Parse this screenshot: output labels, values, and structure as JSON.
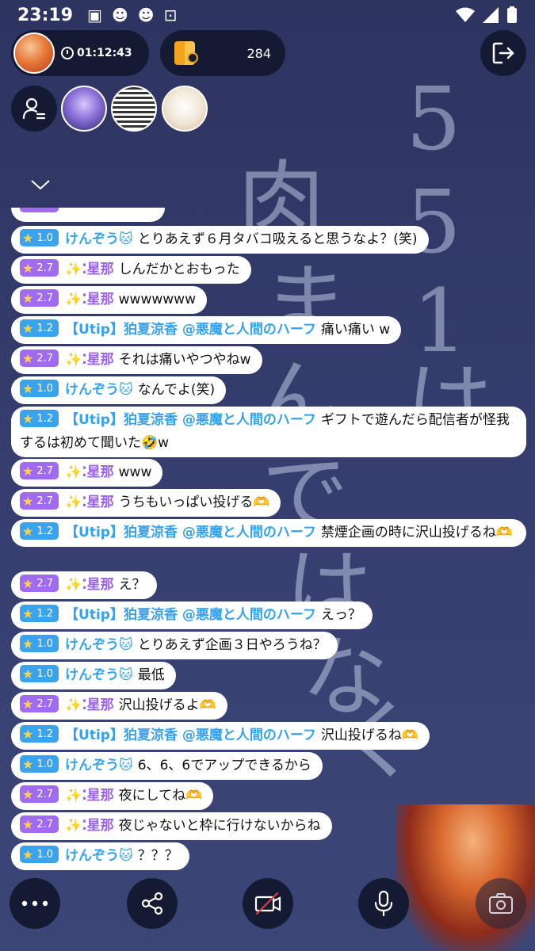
{
  "status_bar": {
    "time": "23:19"
  },
  "host": {
    "timer": "01:12:43"
  },
  "coins": {
    "count": "284"
  },
  "background_text": [
    "5",
    "5",
    "1",
    "は",
    "肉",
    "ま",
    "ん",
    "で",
    "は",
    "な",
    "く"
  ],
  "chat": [
    {
      "level": "2.7",
      "tier": "purple",
      "user": "",
      "text": ""
    },
    {
      "level": "1.0",
      "tier": "blue",
      "user": "けんぞう🐱",
      "text": "とりあえず６月タバコ吸えると思うなよ？(笑)"
    },
    {
      "level": "2.7",
      "tier": "purple",
      "user": "✨⁚星那",
      "text": "しんだかとおもった"
    },
    {
      "level": "2.7",
      "tier": "purple",
      "user": "✨⁚星那",
      "text": "wwwwwww"
    },
    {
      "level": "1.2",
      "tier": "blue",
      "user": "【Utip】狛夏涼香 @悪魔と人間のハーフ",
      "text": "痛い痛い w"
    },
    {
      "level": "2.7",
      "tier": "purple",
      "user": "✨⁚星那",
      "text": "それは痛いやつやねw"
    },
    {
      "level": "1.0",
      "tier": "blue",
      "user": "けんぞう🐱",
      "text": "なんでよ(笑)"
    },
    {
      "level": "1.2",
      "tier": "blue",
      "user": "【Utip】狛夏涼香 @悪魔と人間のハーフ",
      "text": "ギフトで遊んだら配信者が怪我するは初めて聞いた🤣w"
    },
    {
      "level": "2.7",
      "tier": "purple",
      "user": "✨⁚星那",
      "text": "www"
    },
    {
      "level": "2.7",
      "tier": "purple",
      "user": "✨⁚星那",
      "text": "うちもいっぱい投げる🫶"
    },
    {
      "level": "1.2",
      "tier": "blue",
      "user": "【Utip】狛夏涼香 @悪魔と人間のハーフ",
      "text": "禁煙企画の時に沢山投げるね🫶"
    },
    {
      "level": "2.7",
      "tier": "purple",
      "user": "✨⁚星那",
      "text": "え？"
    },
    {
      "level": "1.2",
      "tier": "blue",
      "user": "【Utip】狛夏涼香 @悪魔と人間のハーフ",
      "text": "えっ？"
    },
    {
      "level": "1.0",
      "tier": "blue",
      "user": "けんぞう🐱",
      "text": "とりあえず企画３日やろうね？"
    },
    {
      "level": "1.0",
      "tier": "blue",
      "user": "けんぞう🐱",
      "text": "最低"
    },
    {
      "level": "2.7",
      "tier": "purple",
      "user": "✨⁚星那",
      "text": "沢山投げるよ🫶"
    },
    {
      "level": "1.2",
      "tier": "blue",
      "user": "【Utip】狛夏涼香 @悪魔と人間のハーフ",
      "text": "沢山投げるね🫶"
    },
    {
      "level": "1.0",
      "tier": "blue",
      "user": "けんぞう🐱",
      "text": "6、6、6でアップできるから"
    },
    {
      "level": "2.7",
      "tier": "purple",
      "user": "✨⁚星那",
      "text": "夜にしてね🫶"
    },
    {
      "level": "2.7",
      "tier": "purple",
      "user": "✨⁚星那",
      "text": "夜じゃないと枠に行けないからね"
    },
    {
      "level": "1.0",
      "tier": "blue",
      "user": "けんぞう🐱",
      "text": "？？？"
    }
  ],
  "icons": {
    "exit": "exit-icon",
    "viewers": "viewer-list-icon",
    "collapse": "chevron-down-icon",
    "more": "more-icon",
    "share": "share-icon",
    "camera": "camera-off-icon",
    "mic": "mic-icon",
    "capture": "screenshot-icon"
  }
}
